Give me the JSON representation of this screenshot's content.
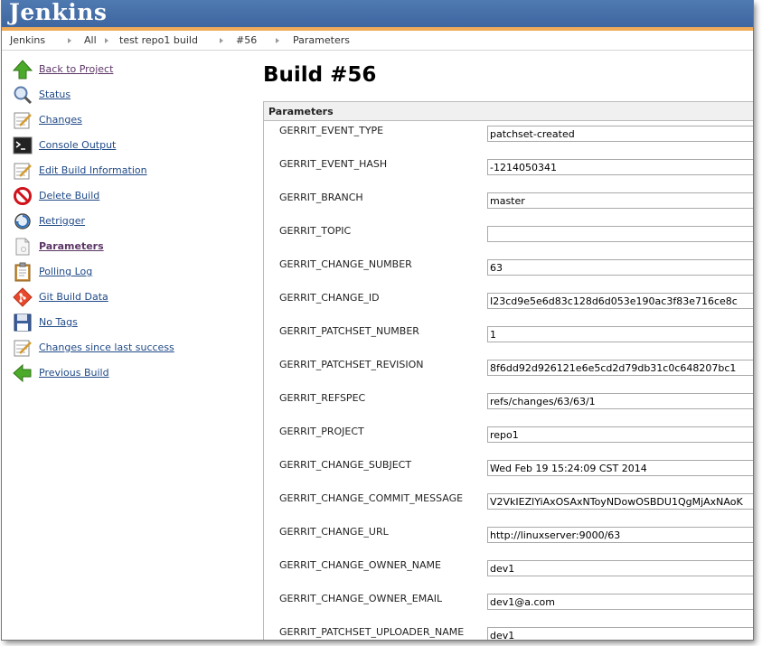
{
  "header": {
    "logo": "Jenkins"
  },
  "breadcrumb": [
    "Jenkins",
    "All",
    "test repo1 build",
    "#56",
    "Parameters"
  ],
  "sidebar": {
    "items": [
      {
        "label": "Back to Project",
        "icon": "up-arrow-icon"
      },
      {
        "label": "Status",
        "icon": "magnifier-icon"
      },
      {
        "label": "Changes",
        "icon": "notepad-icon"
      },
      {
        "label": "Console Output",
        "icon": "terminal-icon"
      },
      {
        "label": "Edit Build Information",
        "icon": "notepad-icon"
      },
      {
        "label": "Delete Build",
        "icon": "no-entry-icon"
      },
      {
        "label": "Retrigger",
        "icon": "retrigger-icon"
      },
      {
        "label": "Parameters",
        "icon": "document-icon"
      },
      {
        "label": "Polling Log",
        "icon": "clipboard-icon"
      },
      {
        "label": "Git Build Data",
        "icon": "git-icon"
      },
      {
        "label": "No Tags",
        "icon": "floppy-icon"
      },
      {
        "label": "Changes since last success",
        "icon": "notepad-icon"
      },
      {
        "label": "Previous Build",
        "icon": "left-arrow-icon"
      }
    ]
  },
  "main": {
    "title": "Build #56",
    "panel_title": "Parameters",
    "params": [
      {
        "name": "GERRIT_EVENT_TYPE",
        "value": "patchset-created"
      },
      {
        "name": "GERRIT_EVENT_HASH",
        "value": "-1214050341"
      },
      {
        "name": "GERRIT_BRANCH",
        "value": "master"
      },
      {
        "name": "GERRIT_TOPIC",
        "value": ""
      },
      {
        "name": "GERRIT_CHANGE_NUMBER",
        "value": "63"
      },
      {
        "name": "GERRIT_CHANGE_ID",
        "value": "I23cd9e5e6d83c128d6d053e190ac3f83e716ce8c"
      },
      {
        "name": "GERRIT_PATCHSET_NUMBER",
        "value": "1"
      },
      {
        "name": "GERRIT_PATCHSET_REVISION",
        "value": "8f6dd92d926121e6e5cd2d79db31c0c648207bc1"
      },
      {
        "name": "GERRIT_REFSPEC",
        "value": "refs/changes/63/63/1"
      },
      {
        "name": "GERRIT_PROJECT",
        "value": "repo1"
      },
      {
        "name": "GERRIT_CHANGE_SUBJECT",
        "value": "Wed Feb 19 15:24:09 CST 2014"
      },
      {
        "name": "GERRIT_CHANGE_COMMIT_MESSAGE",
        "value": "V2VkIEZlYiAxOSAxNToyNDowOSBDU1QgMjAxNAoK"
      },
      {
        "name": "GERRIT_CHANGE_URL",
        "value": "http://linuxserver:9000/63"
      },
      {
        "name": "GERRIT_CHANGE_OWNER_NAME",
        "value": "dev1"
      },
      {
        "name": "GERRIT_CHANGE_OWNER_EMAIL",
        "value": "dev1@a.com"
      },
      {
        "name": "GERRIT_PATCHSET_UPLOADER_NAME",
        "value": "dev1"
      }
    ]
  },
  "colors": {
    "header": "#3e66a0",
    "accent_bar": "#f0ab5a",
    "link": "#204a87",
    "visited_link": "#5c3566"
  }
}
